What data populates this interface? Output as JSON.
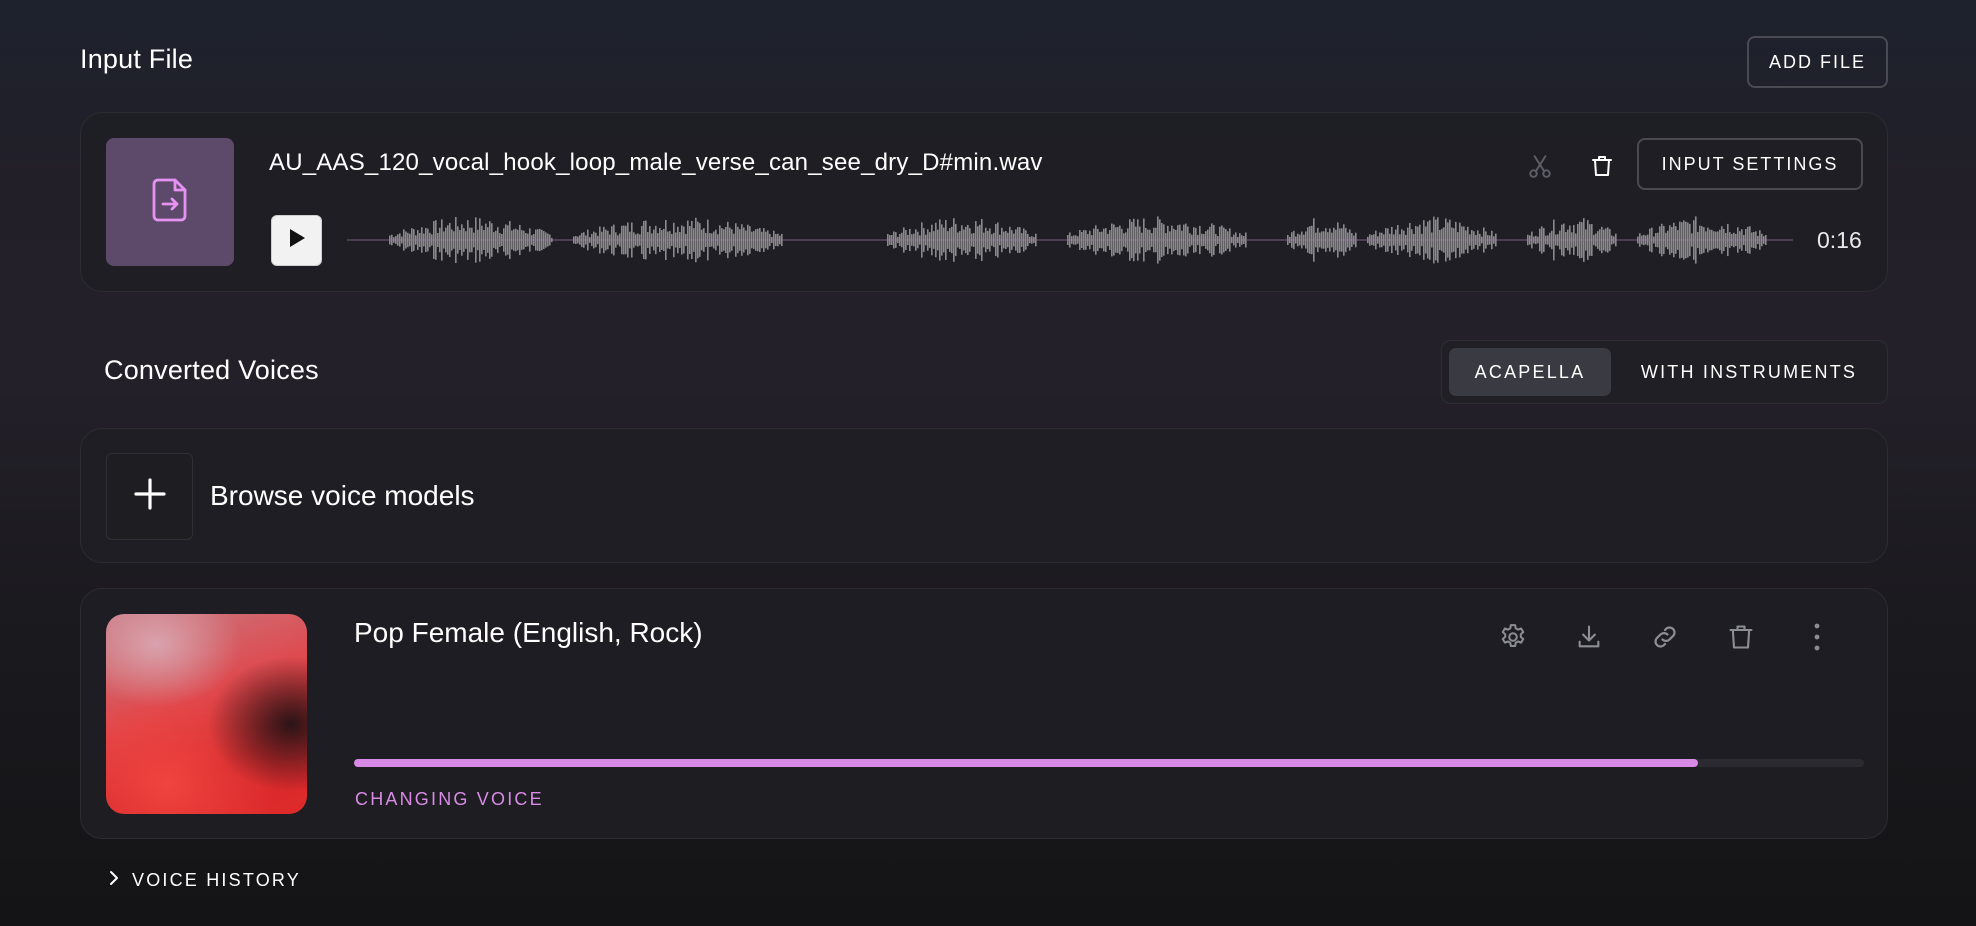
{
  "input_file": {
    "title": "Input File",
    "add_file_label": "ADD FILE",
    "file_name": "AU_AAS_120_vocal_hook_loop_male_verse_can_see_dry_D#min.wav",
    "duration": "0:16",
    "input_settings_label": "INPUT SETTINGS",
    "icons": [
      "file-import-icon",
      "play-icon",
      "scissors-icon",
      "trash-icon"
    ]
  },
  "converted": {
    "title": "Converted Voices",
    "tabs": [
      {
        "label": "ACAPELLA",
        "active": true
      },
      {
        "label": "WITH INSTRUMENTS",
        "active": false
      }
    ],
    "browse_label": "Browse voice models"
  },
  "voice": {
    "name": "Pop Female (English, Rock)",
    "status": "CHANGING VOICE",
    "progress": 0.89,
    "icons": [
      "settings-icon",
      "download-icon",
      "link-icon",
      "trash-icon",
      "more-vertical-icon"
    ]
  },
  "history": {
    "label": "VOICE HISTORY"
  },
  "colors": {
    "accent": "#d98ae6",
    "file_thumb": "#5d4a6a",
    "waveform": "#8a8a8e"
  }
}
